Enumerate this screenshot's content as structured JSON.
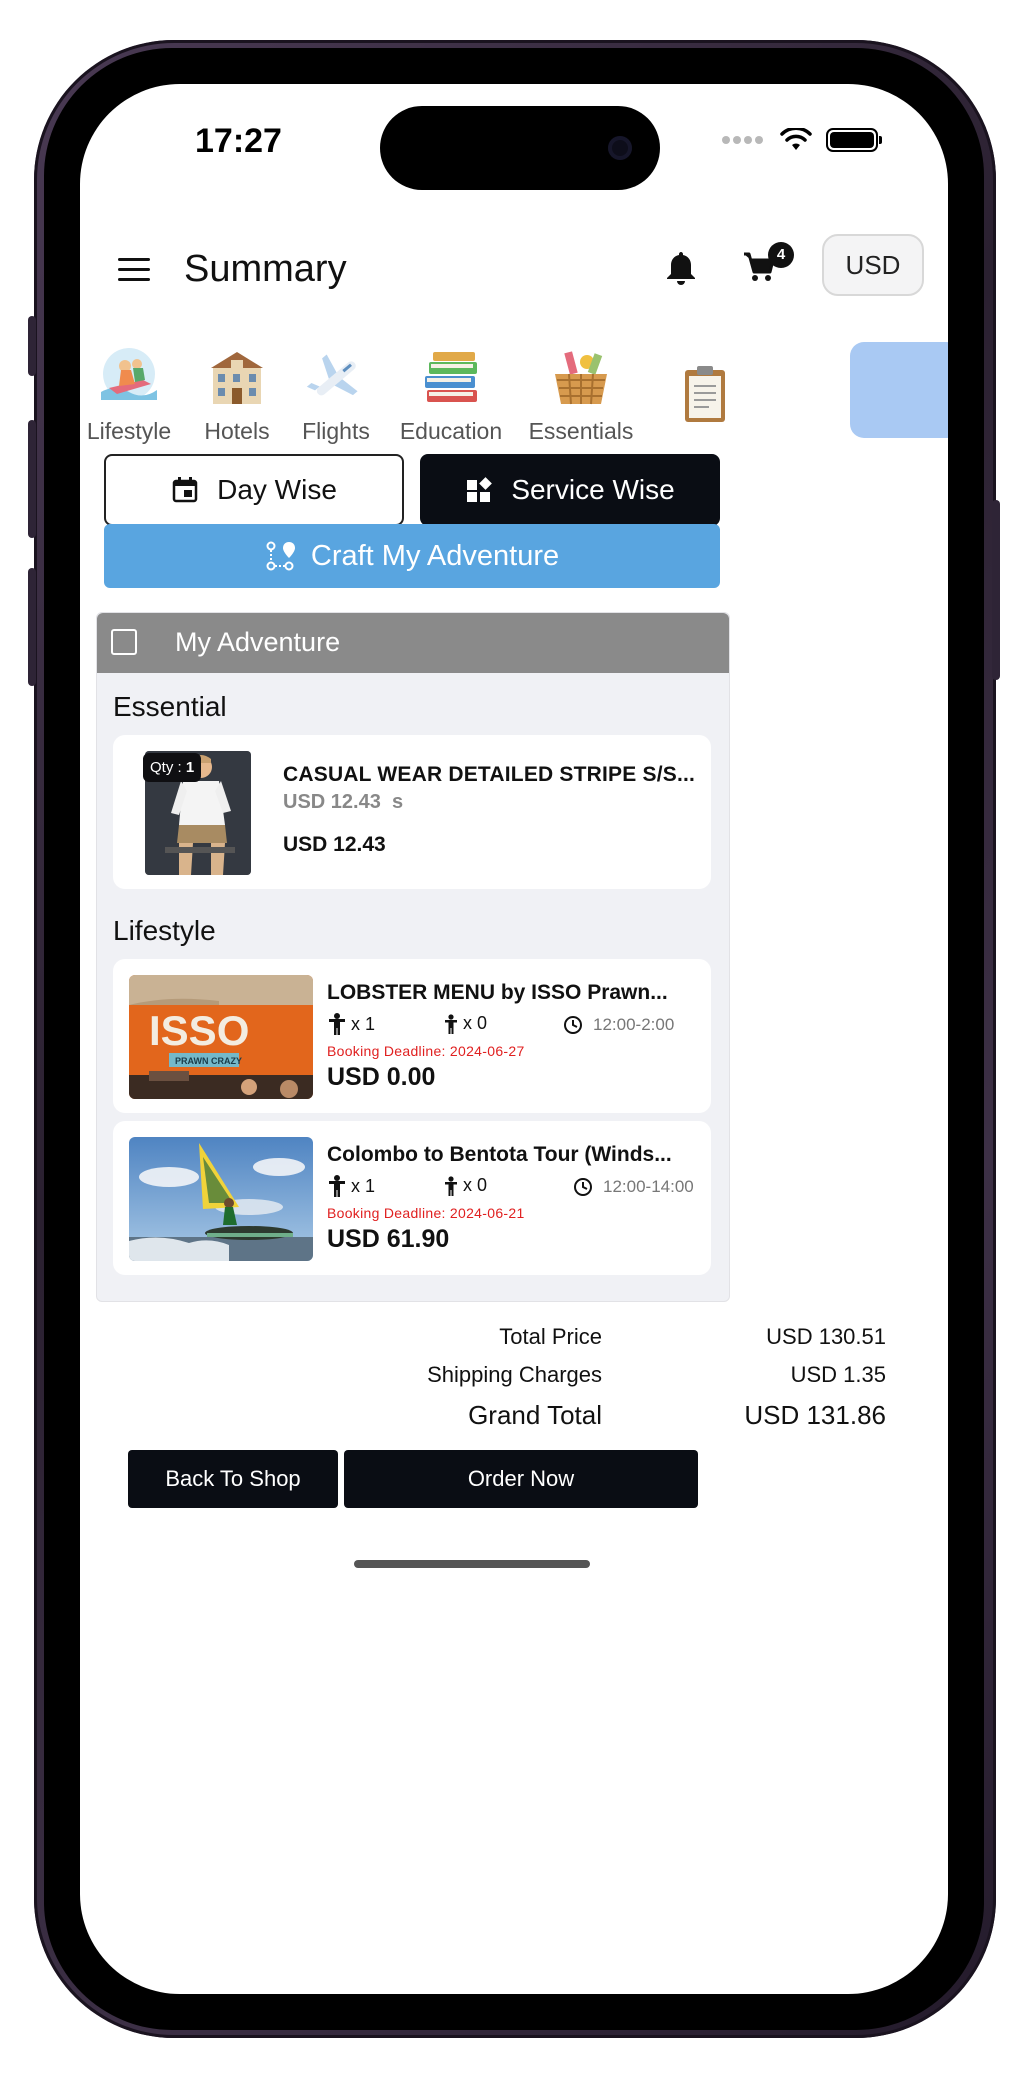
{
  "status": {
    "time": "17:27"
  },
  "header": {
    "title": "Summary",
    "cart_count": "4",
    "currency": "USD"
  },
  "categories": [
    {
      "label": "Lifestyle",
      "icon": "jetski-icon"
    },
    {
      "label": "Hotels",
      "icon": "hotel-icon"
    },
    {
      "label": "Flights",
      "icon": "airplane-icon"
    },
    {
      "label": "Education",
      "icon": "books-icon"
    },
    {
      "label": "Essentials",
      "icon": "basket-icon"
    },
    {
      "label": "",
      "icon": "clipboard-icon",
      "active": true
    }
  ],
  "view_toggle": {
    "day_label": "Day Wise",
    "service_label": "Service Wise",
    "selected": "Service Wise"
  },
  "craft_button": "Craft My Adventure",
  "adventure": {
    "title": "My Adventure",
    "essential": {
      "section_title": "Essential",
      "item": {
        "qty_label": "Qty :",
        "qty_value": "1",
        "name": "CASUAL WEAR DETAILED STRIPE S/S...",
        "sub_price": "USD 12.43",
        "size": "s",
        "price": "USD 12.43"
      }
    },
    "lifestyle": {
      "section_title": "Lifestyle",
      "items": [
        {
          "name": "LOBSTER MENU by ISSO Prawn...",
          "adults": "x 1",
          "children": "x 0",
          "time": "12:00-2:00",
          "deadline": "Booking Deadline: 2024-06-27",
          "price": "USD 0.00",
          "image_text": "ISSO",
          "image_subtext": "PRAWN CRAZY"
        },
        {
          "name": "Colombo to Bentota Tour (Winds...",
          "adults": "x 1",
          "children": "x 0",
          "time": "12:00-14:00",
          "deadline": "Booking Deadline: 2024-06-21",
          "price": "USD 61.90"
        }
      ]
    }
  },
  "totals": {
    "total_label": "Total Price",
    "total_value": "USD 130.51",
    "shipping_label": "Shipping Charges",
    "shipping_value": "USD 1.35",
    "grand_label": "Grand Total",
    "grand_value": "USD 131.86"
  },
  "actions": {
    "back_label": "Back To Shop",
    "order_label": "Order Now"
  },
  "colors": {
    "accent_blue": "#59a5e0",
    "active_tab": "#a9c9f3",
    "dark_button": "#0a0d14",
    "deadline_red": "#e02020"
  }
}
